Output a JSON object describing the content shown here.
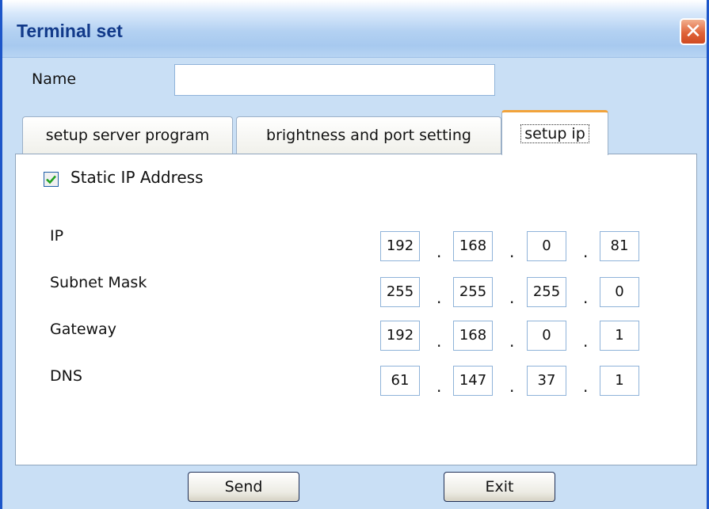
{
  "window": {
    "title": "Terminal set",
    "close_glyph": "✕"
  },
  "name_field": {
    "label": "Name",
    "value": ""
  },
  "tabs": [
    {
      "label": "setup server program",
      "active": false
    },
    {
      "label": "brightness and port setting",
      "active": false
    },
    {
      "label": "setup ip",
      "active": true
    }
  ],
  "static_ip": {
    "label": "Static IP Address",
    "checked": true
  },
  "ip_rows": [
    {
      "label": "IP",
      "octets": [
        "192",
        "168",
        "0",
        "81"
      ]
    },
    {
      "label": "Subnet Mask",
      "octets": [
        "255",
        "255",
        "255",
        "0"
      ]
    },
    {
      "label": "Gateway",
      "octets": [
        "192",
        "168",
        "0",
        "1"
      ]
    },
    {
      "label": "DNS",
      "octets": [
        "61",
        "147",
        "37",
        "1"
      ]
    }
  ],
  "buttons": {
    "send": "Send",
    "exit": "Exit"
  },
  "colors": {
    "title_text": "#123a8a",
    "window_border": "#1d56c9",
    "active_tab_accent": "#f2a33a",
    "close_button": "#e0643a"
  }
}
